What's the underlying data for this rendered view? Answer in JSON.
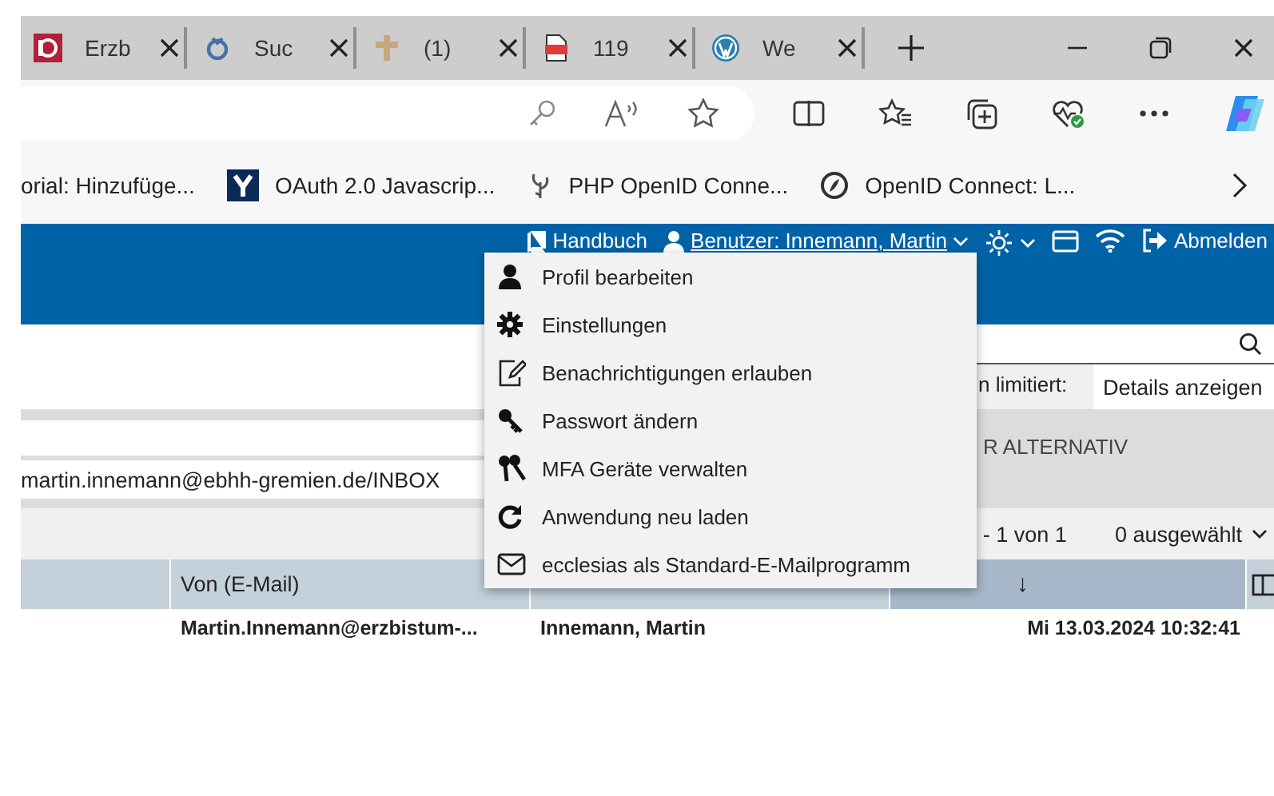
{
  "browser": {
    "tabs": [
      {
        "title": "Erzb"
      },
      {
        "title": "Suc"
      },
      {
        "title": "(1)"
      },
      {
        "title": "119"
      },
      {
        "title": "We"
      }
    ],
    "bookmarks": [
      {
        "title": "orial: Hinzufüge..."
      },
      {
        "title": "OAuth 2.0 Javascrip..."
      },
      {
        "title": "PHP OpenID Conne..."
      },
      {
        "title": "OpenID Connect: L..."
      }
    ]
  },
  "header": {
    "manual": "Handbuch",
    "user": "Benutzer: Innemann, Martin",
    "logout": "Abmelden"
  },
  "user_menu": {
    "items": [
      {
        "label": "Profil bearbeiten"
      },
      {
        "label": "Einstellungen"
      },
      {
        "label": "Benachrichtigungen erlauben"
      },
      {
        "label": "Passwort ändern"
      },
      {
        "label": "MFA Geräte verwalten"
      },
      {
        "label": "Anwendung neu laden"
      },
      {
        "label": "ecclesias als Standard-E-Mailprogramm"
      }
    ]
  },
  "limit_label": "n limitiert:",
  "details_button": "Details anzeigen",
  "mailbox_path": "martin.innemann@ebhh-gremien.de/INBOX",
  "filter_label": "R ALTERNATIV",
  "paging": "- 1 von 1",
  "selection": "0 ausgewählt",
  "table": {
    "columns": [
      {
        "label": "Von (E-Mail)",
        "sorted": false
      },
      {
        "sorted": false
      },
      {
        "sorted": true,
        "sort_indicator": "↓"
      }
    ],
    "rows": [
      {
        "cells": [
          "Martin.Innemann@erzbistum-...",
          "Innemann, Martin",
          "Mi 13.03.2024 10:32:41"
        ]
      }
    ]
  }
}
